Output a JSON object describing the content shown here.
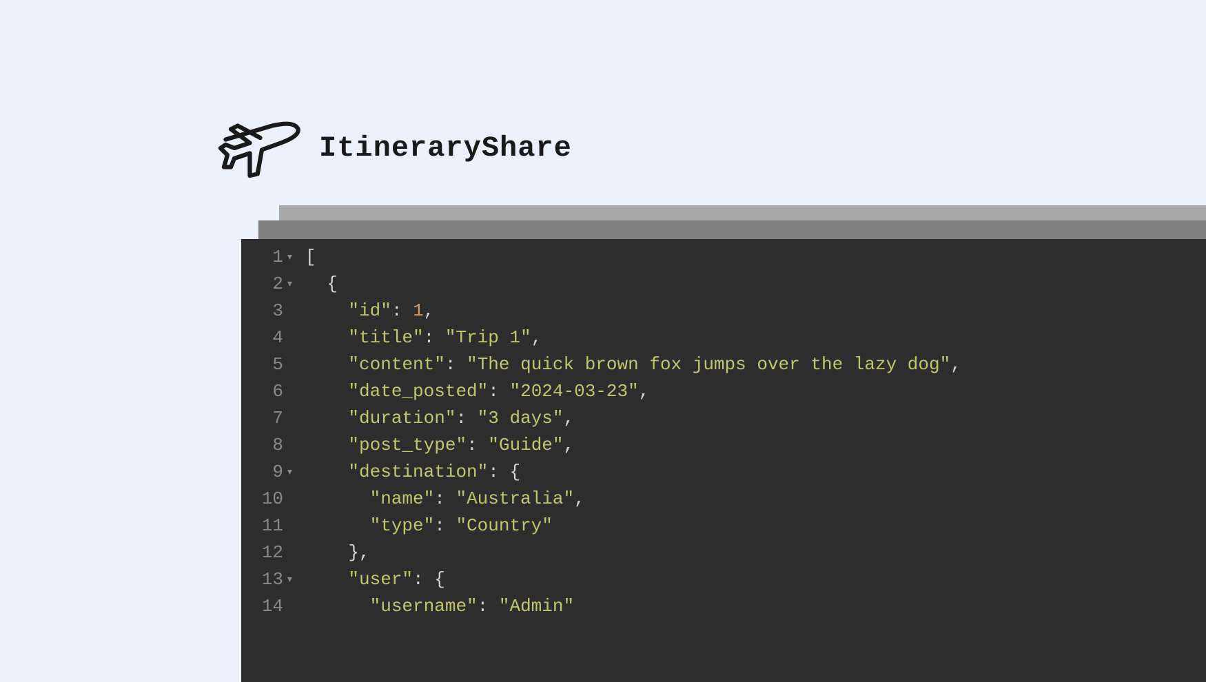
{
  "logo": {
    "text": "ItineraryShare"
  },
  "editor": {
    "lines": [
      {
        "num": "1",
        "foldable": true,
        "indent": 0,
        "tokens": [
          {
            "t": "bracket",
            "v": "["
          }
        ]
      },
      {
        "num": "2",
        "foldable": true,
        "indent": 1,
        "tokens": [
          {
            "t": "bracket",
            "v": "{"
          }
        ]
      },
      {
        "num": "3",
        "foldable": false,
        "indent": 2,
        "tokens": [
          {
            "t": "key",
            "v": "\"id\""
          },
          {
            "t": "punct",
            "v": ": "
          },
          {
            "t": "number",
            "v": "1"
          },
          {
            "t": "punct",
            "v": ","
          }
        ]
      },
      {
        "num": "4",
        "foldable": false,
        "indent": 2,
        "tokens": [
          {
            "t": "key",
            "v": "\"title\""
          },
          {
            "t": "punct",
            "v": ": "
          },
          {
            "t": "string",
            "v": "\"Trip 1\""
          },
          {
            "t": "punct",
            "v": ","
          }
        ]
      },
      {
        "num": "5",
        "foldable": false,
        "indent": 2,
        "tokens": [
          {
            "t": "key",
            "v": "\"content\""
          },
          {
            "t": "punct",
            "v": ": "
          },
          {
            "t": "string",
            "v": "\"The quick brown fox jumps over the lazy dog\""
          },
          {
            "t": "punct",
            "v": ","
          }
        ]
      },
      {
        "num": "6",
        "foldable": false,
        "indent": 2,
        "tokens": [
          {
            "t": "key",
            "v": "\"date_posted\""
          },
          {
            "t": "punct",
            "v": ": "
          },
          {
            "t": "string",
            "v": "\"2024-03-23\""
          },
          {
            "t": "punct",
            "v": ","
          }
        ]
      },
      {
        "num": "7",
        "foldable": false,
        "indent": 2,
        "tokens": [
          {
            "t": "key",
            "v": "\"duration\""
          },
          {
            "t": "punct",
            "v": ": "
          },
          {
            "t": "string",
            "v": "\"3 days\""
          },
          {
            "t": "punct",
            "v": ","
          }
        ]
      },
      {
        "num": "8",
        "foldable": false,
        "indent": 2,
        "tokens": [
          {
            "t": "key",
            "v": "\"post_type\""
          },
          {
            "t": "punct",
            "v": ": "
          },
          {
            "t": "string",
            "v": "\"Guide\""
          },
          {
            "t": "punct",
            "v": ","
          }
        ]
      },
      {
        "num": "9",
        "foldable": true,
        "indent": 2,
        "tokens": [
          {
            "t": "key",
            "v": "\"destination\""
          },
          {
            "t": "punct",
            "v": ": "
          },
          {
            "t": "bracket",
            "v": "{"
          }
        ]
      },
      {
        "num": "10",
        "foldable": false,
        "indent": 3,
        "tokens": [
          {
            "t": "key",
            "v": "\"name\""
          },
          {
            "t": "punct",
            "v": ": "
          },
          {
            "t": "string",
            "v": "\"Australia\""
          },
          {
            "t": "punct",
            "v": ","
          }
        ]
      },
      {
        "num": "11",
        "foldable": false,
        "indent": 3,
        "tokens": [
          {
            "t": "key",
            "v": "\"type\""
          },
          {
            "t": "punct",
            "v": ": "
          },
          {
            "t": "string",
            "v": "\"Country\""
          }
        ]
      },
      {
        "num": "12",
        "foldable": false,
        "indent": 2,
        "tokens": [
          {
            "t": "bracket",
            "v": "}"
          },
          {
            "t": "punct",
            "v": ","
          }
        ]
      },
      {
        "num": "13",
        "foldable": true,
        "indent": 2,
        "tokens": [
          {
            "t": "key",
            "v": "\"user\""
          },
          {
            "t": "punct",
            "v": ": "
          },
          {
            "t": "bracket",
            "v": "{"
          }
        ]
      },
      {
        "num": "14",
        "foldable": false,
        "indent": 3,
        "tokens": [
          {
            "t": "key",
            "v": "\"username\""
          },
          {
            "t": "punct",
            "v": ": "
          },
          {
            "t": "string",
            "v": "\"Admin\""
          }
        ]
      }
    ]
  }
}
